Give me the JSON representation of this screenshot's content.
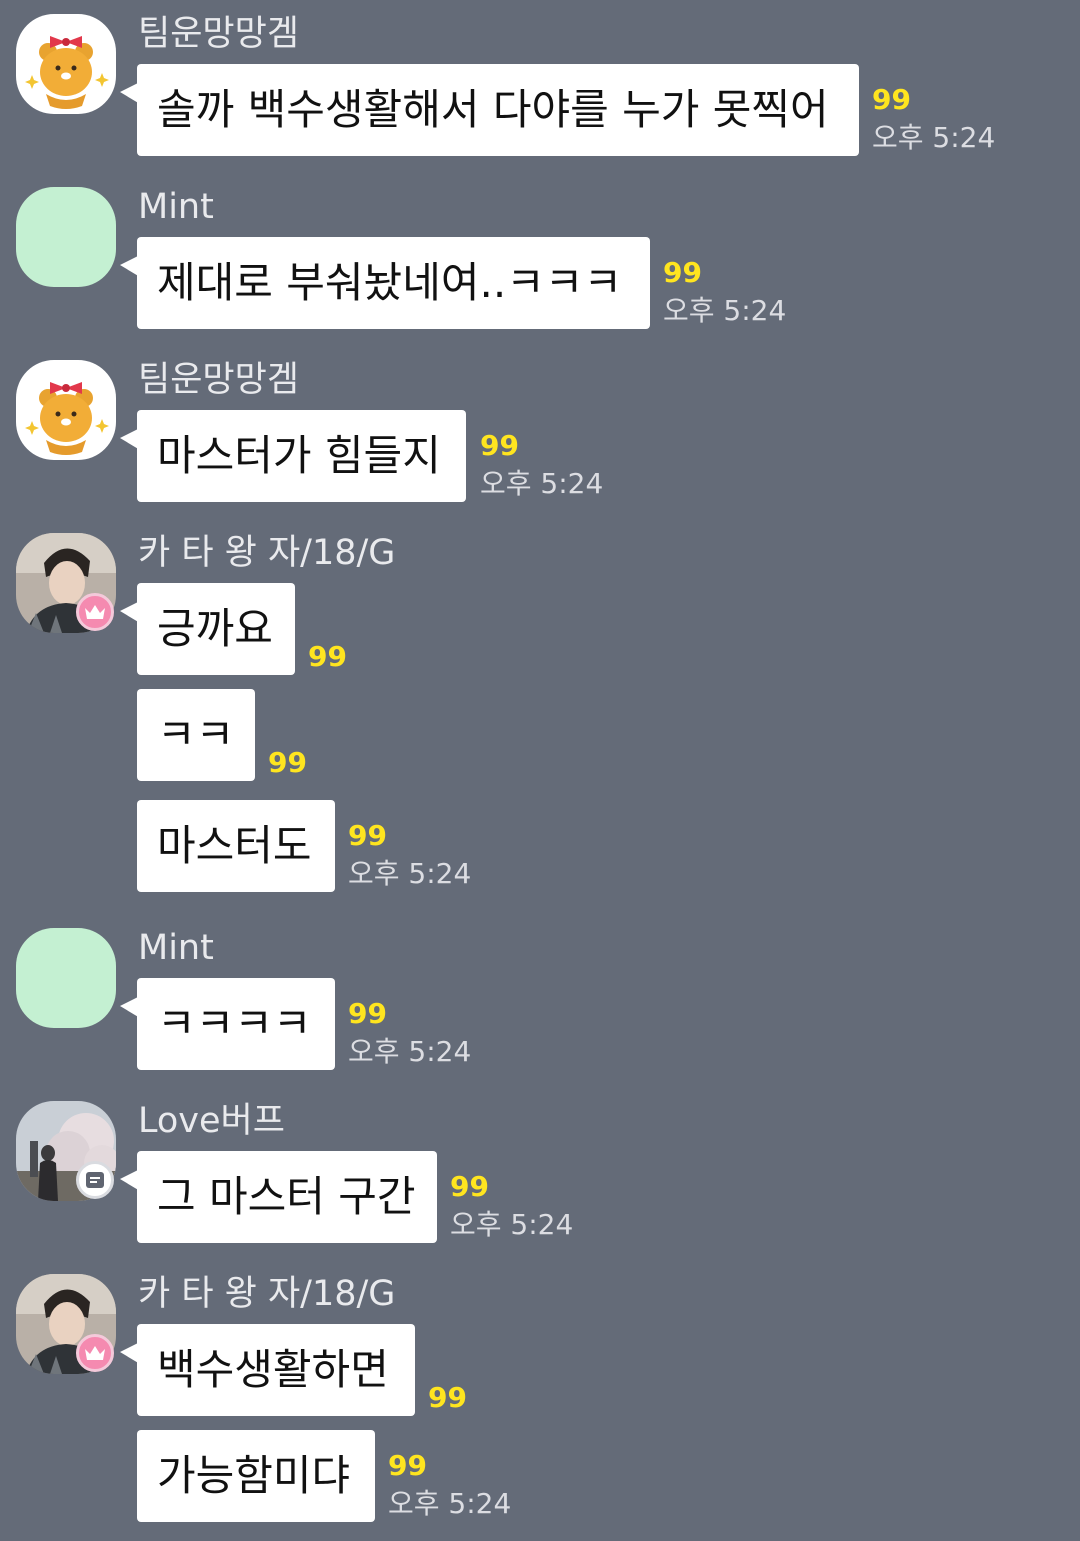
{
  "messages_area": {
    "groups": [
      {
        "sender": "팀운망망겜",
        "avatar": "ryan-character-icon",
        "messages": [
          {
            "text": "솔까 백수생활해서 다야를 누가 못찍어",
            "unread": "99",
            "time": "오후 5:24"
          }
        ]
      },
      {
        "sender": "Mint",
        "avatar": "mint-green-blank-avatar",
        "messages": [
          {
            "text": "제대로 부숴놨네여..ㅋㅋㅋ",
            "unread": "99",
            "time": "오후 5:24"
          }
        ]
      },
      {
        "sender": "팀운망망겜",
        "avatar": "ryan-character-icon",
        "messages": [
          {
            "text": "마스터가 힘들지",
            "unread": "99",
            "time": "오후 5:24"
          }
        ]
      },
      {
        "sender": "카 타 왕 자/18/G",
        "avatar": "person-photo-avatar",
        "badge": "crown-icon",
        "messages": [
          {
            "text": "긍까요",
            "unread": "99",
            "time": ""
          },
          {
            "text": "ㅋㅋ",
            "unread": "99",
            "time": ""
          },
          {
            "text": "마스터도",
            "unread": "99",
            "time": "오후 5:24"
          }
        ]
      },
      {
        "sender": "Mint",
        "avatar": "mint-green-blank-avatar",
        "messages": [
          {
            "text": "ㅋㅋㅋㅋ",
            "unread": "99",
            "time": "오후 5:24"
          }
        ]
      },
      {
        "sender": "Love버프",
        "avatar": "cherry-blossom-photo-avatar",
        "badge": "profile-card-icon",
        "messages": [
          {
            "text": "그 마스터 구간",
            "unread": "99",
            "time": "오후 5:24"
          }
        ]
      },
      {
        "sender": "카 타 왕 자/18/G",
        "avatar": "person-photo-avatar",
        "badge": "crown-icon",
        "messages": [
          {
            "text": "백수생활하면",
            "unread": "99",
            "time": ""
          },
          {
            "text": "가능함미댜",
            "unread": "99",
            "time": "오후 5:24"
          }
        ]
      }
    ]
  },
  "colors": {
    "background": "#646b78",
    "bubble": "#ffffff",
    "unread": "#ffe51f",
    "mint_avatar": "#c4f0d2",
    "crown_badge": "#f58ab0"
  }
}
